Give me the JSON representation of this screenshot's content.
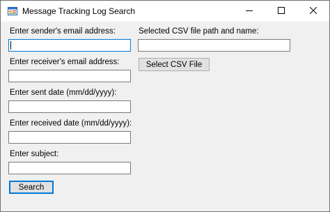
{
  "window": {
    "title": "Message Tracking Log Search",
    "app_icon": "form-window-icon",
    "controls": [
      "minimize-icon",
      "maximize-icon",
      "close-icon"
    ]
  },
  "form": {
    "sender_label": "Enter sender's email address:",
    "sender_value": "",
    "receiver_label": "Enter receiver's email address:",
    "receiver_value": "",
    "sent_date_label": "Enter sent date (mm/dd/yyyy):",
    "sent_date_value": "",
    "received_date_label": "Enter received date (mm/dd/yyyy):",
    "received_date_value": "",
    "subject_label": "Enter subject:",
    "subject_value": "",
    "csv_label": "Selected CSV file path and name:",
    "csv_value": "",
    "select_csv_button": "Select CSV File",
    "search_button": "Search"
  },
  "colors": {
    "focus_border": "#0078d7",
    "window_bg": "#f0f0f0",
    "titlebar_bg": "#ffffff"
  }
}
